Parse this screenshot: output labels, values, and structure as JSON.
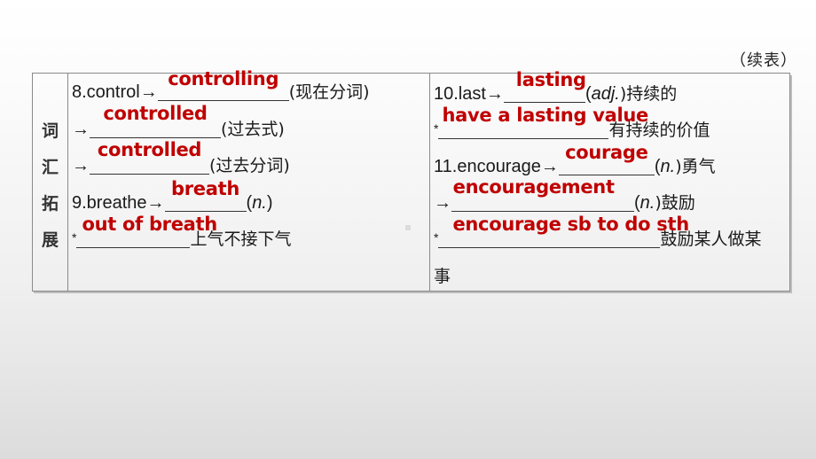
{
  "continued_label": "（续表）",
  "section_title_chars": [
    "词",
    "汇",
    "拓",
    "展"
  ],
  "left_column": {
    "item8": {
      "prefix": "8.control→",
      "blank_answer": "controlling",
      "suffix": "(现在分词)"
    },
    "item8_past": {
      "prefix": "→",
      "blank_answer": "controlled",
      "suffix": "(过去式)"
    },
    "item8_pp": {
      "prefix": "→",
      "blank_answer": "controlled",
      "suffix": "(过去分词)"
    },
    "item9": {
      "prefix": "9.breathe→",
      "blank_answer": "breath",
      "suffix_open": "(",
      "suffix_pos": "n.",
      "suffix_close": ")"
    },
    "item9_phrase": {
      "prefix": "*",
      "blank_answer": "out of breath",
      "suffix": "上气不接下气"
    }
  },
  "right_column": {
    "item10": {
      "prefix": "10.last→",
      "blank_answer": "lasting",
      "suffix_open": "(",
      "suffix_pos": "adj.",
      "suffix_close": ")持续的"
    },
    "item10_phrase": {
      "prefix": "*",
      "blank_answer": "have a lasting value",
      "suffix": "有持续的价值"
    },
    "item11": {
      "prefix": "11.encourage→",
      "blank_answer": "courage",
      "suffix_open": "(",
      "suffix_pos": "n.",
      "suffix_close": ")勇气"
    },
    "item11_noun": {
      "prefix": "→",
      "blank_answer": "encouragement",
      "suffix_open": "(",
      "suffix_pos": "n.",
      "suffix_close": ")鼓励"
    },
    "item11_phrase": {
      "prefix": "*",
      "blank_answer": "encourage sb to do sth",
      "suffix": "鼓励某人做某",
      "continuation": "事"
    }
  },
  "colors": {
    "answer": "#c00000",
    "text": "#1a1a1a",
    "border": "#8a8a8a"
  }
}
